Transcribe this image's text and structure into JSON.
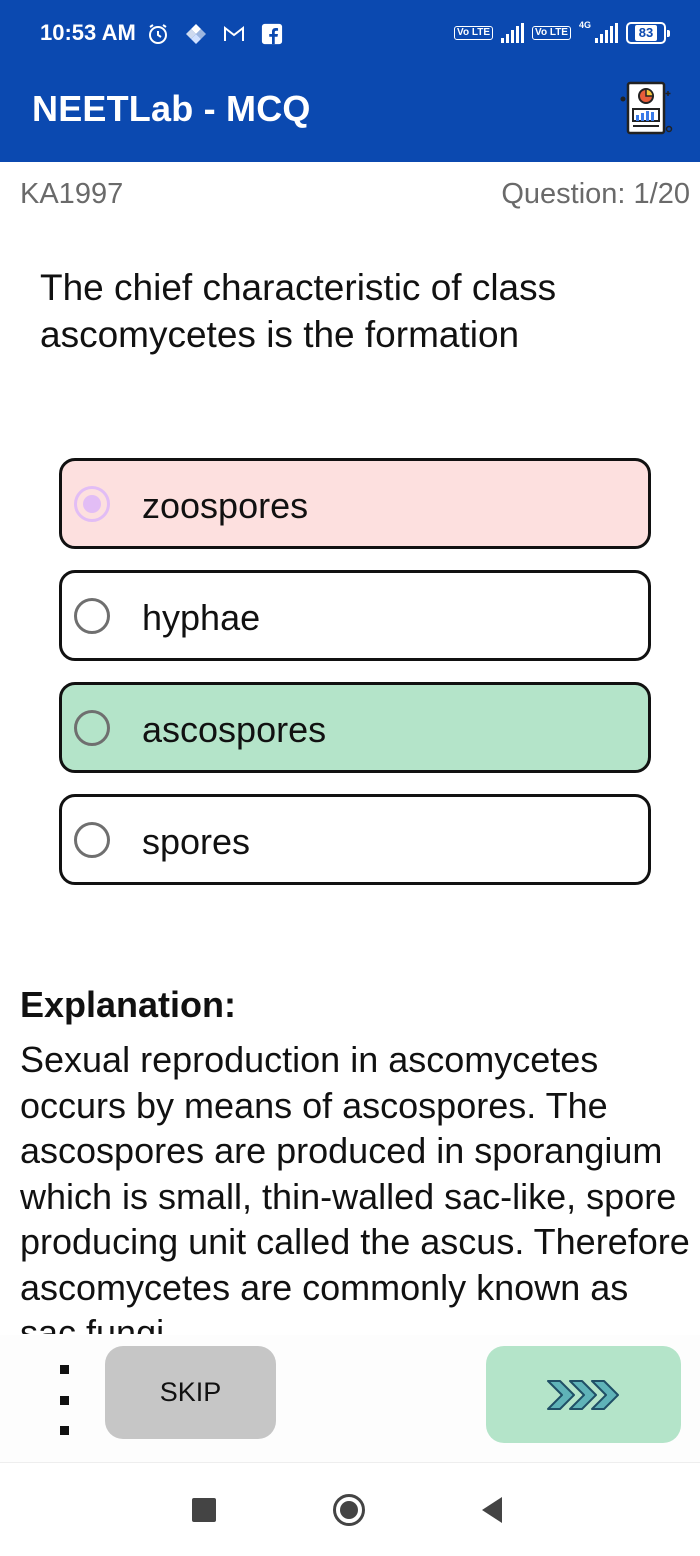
{
  "status_bar": {
    "time": "10:53 AM",
    "notification_icons": [
      "alarm-icon",
      "photos-icon",
      "gmail-icon",
      "facebook-icon"
    ],
    "volte_label_1": "Vo LTE",
    "volte_label_2": "Vo LTE",
    "network_label": "4G",
    "battery": "83"
  },
  "app_bar": {
    "title": "NEETLab - MCQ",
    "action_icon": "report-icon"
  },
  "meta": {
    "code": "KA1997",
    "question_counter": "Question: 1/20"
  },
  "question": {
    "text": "The chief characteristic of class ascomycetes is the formation"
  },
  "options": [
    {
      "label": "zoospores",
      "state": "selected-wrong"
    },
    {
      "label": "hyphae",
      "state": "default"
    },
    {
      "label": "ascospores",
      "state": "correct"
    },
    {
      "label": "spores",
      "state": "default"
    }
  ],
  "explanation": {
    "title": "Explanation:",
    "text": "Sexual reproduction in ascomycetes occurs by means of ascospores. The ascospores are produced in sporangium which is small, thin-walled sac-like, spore producing unit called the ascus. Therefore ascomycetes are commonly known as sac fungi."
  },
  "actions": {
    "skip_label": "SKIP",
    "next_icon": "fast-forward-chevrons-icon",
    "more_icon": "more-vertical-icon"
  },
  "colors": {
    "app_bar": "#0b49b0",
    "wrong_option_bg": "#fde0df",
    "correct_option_bg": "#b4e4c9",
    "selected_radio": "#e2bdf5",
    "skip_button_bg": "#c6c6c6",
    "next_button_bg": "#b4e4c9",
    "next_chevron": "#5fb3b8"
  },
  "nav_bar": {
    "icons": [
      "recents-square-icon",
      "home-circle-icon",
      "back-triangle-icon"
    ]
  }
}
